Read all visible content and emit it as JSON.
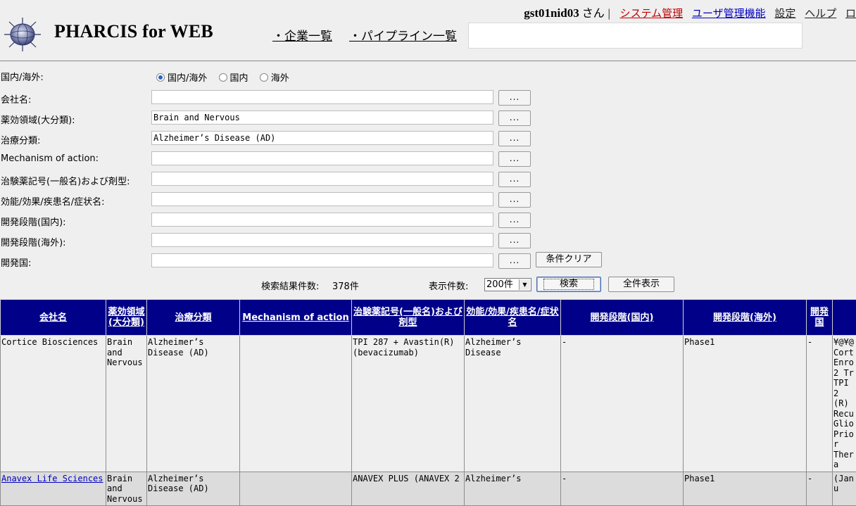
{
  "header": {
    "brand": "PHARCIS for WEB",
    "nav": [
      "・企業一覧",
      "・パイプライン一覧"
    ],
    "user": "gst01nid03",
    "user_suffix": "さん",
    "separator": "|",
    "links": [
      "システム管理",
      "ユーザ管理機能",
      "設定",
      "ヘルプ",
      "ロ"
    ]
  },
  "form": {
    "region_label": "国内/海外:",
    "region_options": [
      "国内/海外",
      "国内",
      "海外"
    ],
    "region_selected": "国内/海外",
    "fields": [
      {
        "label": "会社名:",
        "value": ""
      },
      {
        "label": "薬効領域(大分類):",
        "value": "Brain and Nervous"
      },
      {
        "label": "治療分類:",
        "value": "Alzheimer’s Disease (AD)"
      },
      {
        "label": "Mechanism of action:",
        "value": ""
      },
      {
        "label": "治験薬記号(一般名)および剤型:",
        "value": ""
      },
      {
        "label": "効能/効果/疾患名/症状名:",
        "value": ""
      },
      {
        "label": "開発段階(国内):",
        "value": ""
      },
      {
        "label": "開発段階(海外):",
        "value": ""
      },
      {
        "label": "開発国:",
        "value": ""
      }
    ],
    "picker_label": "...",
    "clear_label": "条件クリア",
    "result_count_label": "検索結果件数:",
    "result_count": "378件",
    "per_page_label": "表示件数:",
    "per_page_value": "200件",
    "search_label": "検索",
    "show_all_label": "全件表示"
  },
  "table": {
    "headers": [
      "会社名",
      "薬効領域(大分類)",
      "治療分類",
      "Mechanism of action",
      "治験薬記号(一般名)および剤型",
      "効能/効果/疾患名/症状名",
      "開発段階(国内)",
      "開発段階(海外)",
      "開発国",
      ""
    ],
    "rows": [
      [
        "Cortice Biosciences",
        "Brain and Nervous",
        "Alzheimer’s Disease (AD)",
        "",
        "TPI 287 + Avastin(R) (bevacizumab)",
        "Alzheimer’s Disease",
        "-",
        "Phase1",
        "-",
        "¥@¥@ Cort Enro 2 Tr TPI 2 (R) Recu Glio Prior Thera"
      ],
      [
        "Anavex Life Sciences",
        "Brain and Nervous",
        "Alzheimer’s Disease (AD)",
        "",
        "ANAVEX PLUS (ANAVEX 2",
        "Alzheimer’s",
        "-",
        "Phase1",
        "-",
        "(Janu"
      ]
    ]
  }
}
